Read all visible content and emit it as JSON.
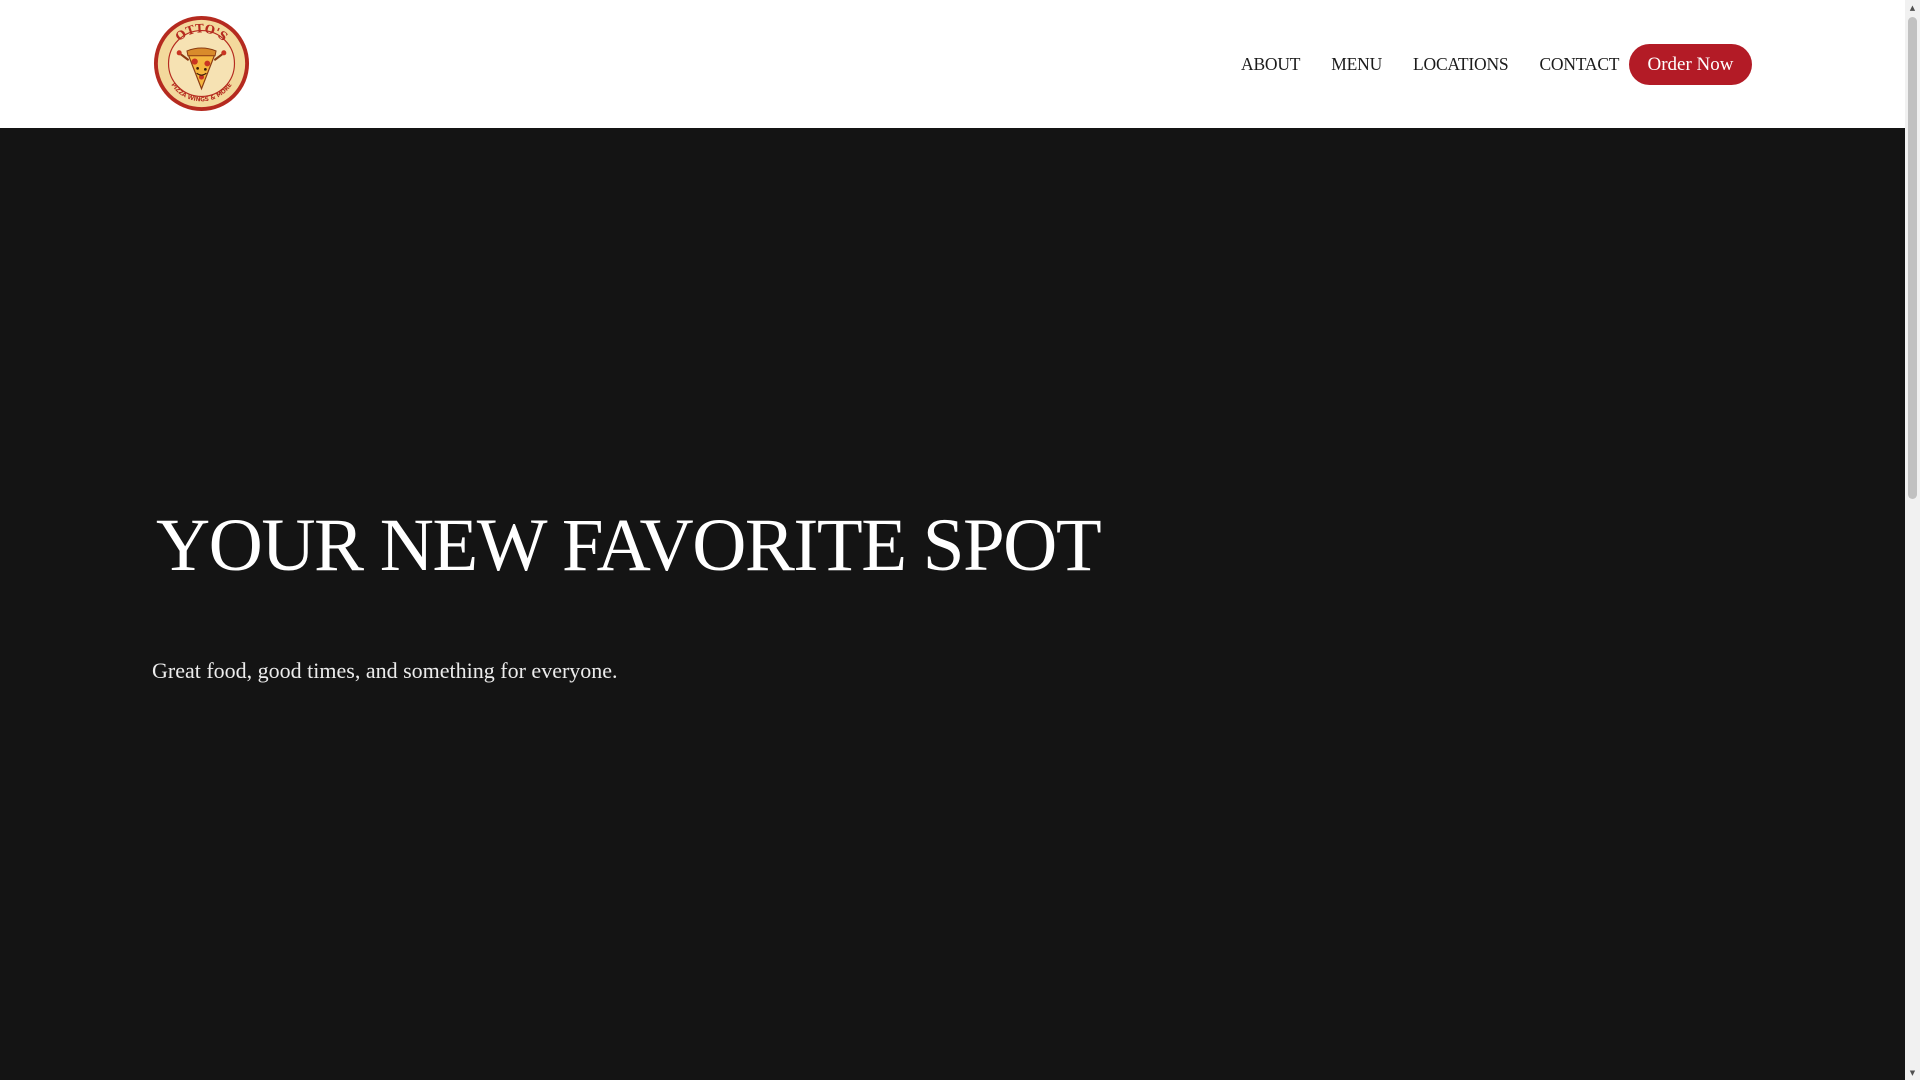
{
  "brand": {
    "logo_top_text": "OTTO'S",
    "logo_bottom_text": "PIZZA WINGS & MORE",
    "colors": {
      "logo_ring": "#b52a1f",
      "logo_fill": "#f6e2b3",
      "accent": "#b31b26"
    }
  },
  "nav": {
    "items": [
      {
        "label": "ABOUT"
      },
      {
        "label": "MENU"
      },
      {
        "label": "LOCATIONS"
      },
      {
        "label": "CONTACT"
      }
    ],
    "cta_label": "Order Now"
  },
  "hero": {
    "title": "YOUR NEW FAVORITE SPOT",
    "subtitle": "Great food, good times, and something for everyone."
  },
  "colors": {
    "hero_bg": "#141414",
    "header_bg": "#ffffff",
    "nav_text": "#1b1b1b",
    "cta_bg": "#b31b26"
  },
  "icons": {
    "logo": "pizza-slice-mascot-logo",
    "scroll_up": "chevron-up-icon",
    "scroll_down": "chevron-down-icon"
  }
}
